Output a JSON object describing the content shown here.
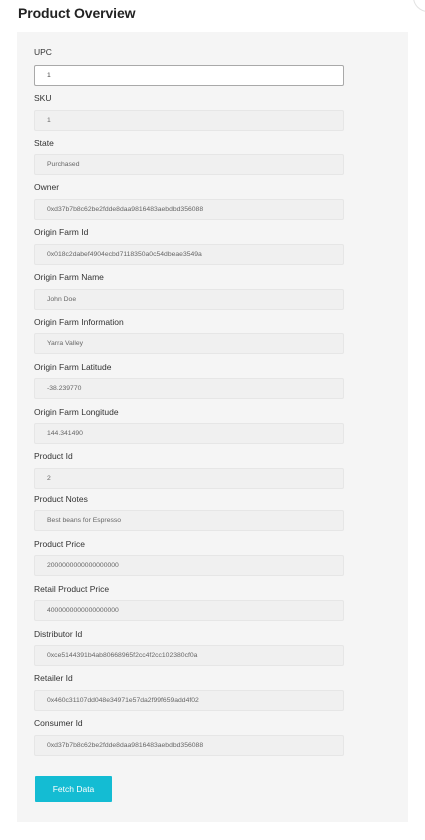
{
  "page": {
    "title": "Product Overview"
  },
  "fields": [
    {
      "label": "UPC",
      "value": "1"
    },
    {
      "label": "SKU",
      "value": "1"
    },
    {
      "label": "State",
      "value": "Purchased"
    },
    {
      "label": "Owner",
      "value": "0xd37b7b8c62be2fdde8daa9816483aebdbd356088"
    },
    {
      "label": "Origin Farm Id",
      "value": "0x018c2dabef4904ecbd7118350a0c54dbeae3549a"
    },
    {
      "label": "Origin Farm Name",
      "value": "John Doe"
    },
    {
      "label": "Origin Farm Information",
      "value": "Yarra Valley"
    },
    {
      "label": "Origin Farm Latitude",
      "value": "-38.239770"
    },
    {
      "label": "Origin Farm Longitude",
      "value": "144.341490"
    },
    {
      "label": "Product Id",
      "value": "2"
    },
    {
      "label": "Product Notes",
      "value": "Best beans for Espresso"
    },
    {
      "label": "Product Price",
      "value": "2000000000000000000"
    },
    {
      "label": "Retail Product Price",
      "value": "4000000000000000000"
    },
    {
      "label": "Distributor Id",
      "value": "0xce5144391b4ab80668965f2cc4f2cc102380cf0a"
    },
    {
      "label": "Retailer Id",
      "value": "0x460c31107dd048e34971e57da2f99f659add4f02"
    },
    {
      "label": "Consumer Id",
      "value": "0xd37b7b8c62be2fdde8daa9816483aebdbd356088"
    }
  ],
  "actions": {
    "fetch_label": "Fetch Data"
  }
}
